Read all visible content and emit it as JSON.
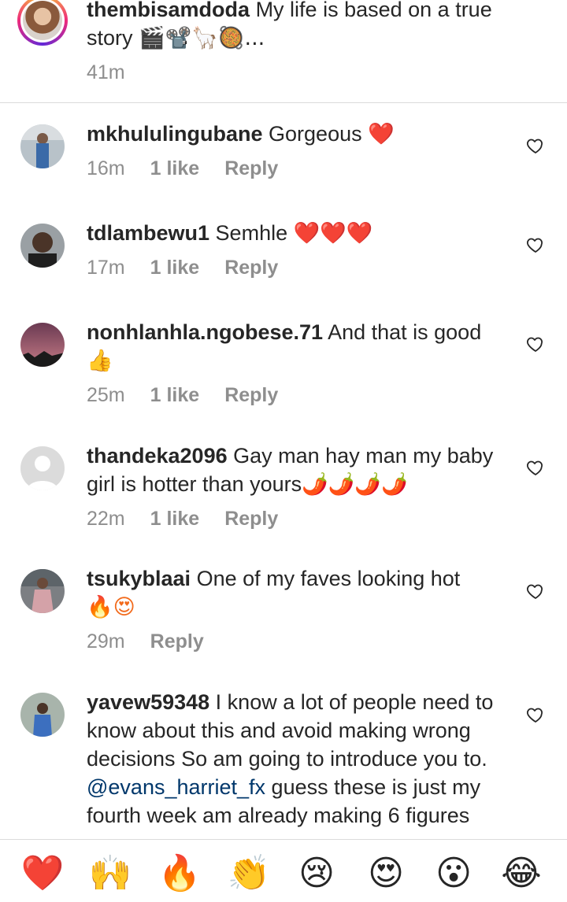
{
  "caption": {
    "username": "thembisamdoda",
    "text_line1": "My life is based on a true",
    "text_line2": "story",
    "text_emojis": "🎬📽️🦙🥘...",
    "time": "41m"
  },
  "comments": [
    {
      "username": "mkhululingubane",
      "text": "Gorgeous",
      "emojis": "❤️",
      "time": "16m",
      "likes": "1 like",
      "reply": "Reply"
    },
    {
      "username": "tdlambewu1",
      "text": "Semhle",
      "emojis": "❤️❤️❤️",
      "time": "17m",
      "likes": "1 like",
      "reply": "Reply"
    },
    {
      "username": "nonhlanhla.ngobese.71",
      "text": "And that is good",
      "emojis": "👍",
      "time": "25m",
      "likes": "1 like",
      "reply": "Reply"
    },
    {
      "username": "thandeka2096",
      "text": "Gay man hay man my baby",
      "text2": "girl is hotter than yours",
      "emojis": "🌶️🌶️🌶️🌶️",
      "time": "22m",
      "likes": "1 like",
      "reply": "Reply"
    },
    {
      "username": "tsukyblaai",
      "text": "One of my faves looking hot",
      "emojis": "🔥😍",
      "time": "29m",
      "reply": "Reply"
    },
    {
      "username": "yavew59348",
      "line1": "I know a lot of people need to",
      "line2": "know about this and avoid making wrong",
      "line3": "decisions So am going to introduce you to.",
      "mention": "@evans_harriet_fx",
      "line4_rest": "guess these is just my",
      "line5": "fourth week am already making 6 figures"
    }
  ],
  "emoji_bar": [
    "❤️",
    "🙌",
    "🔥",
    "👏",
    "😢",
    "😍",
    "😮",
    "😂"
  ],
  "colors": {
    "accent_mention": "#00376b",
    "meta_gray": "#8e8e8e",
    "divider": "#dbdbdb"
  }
}
